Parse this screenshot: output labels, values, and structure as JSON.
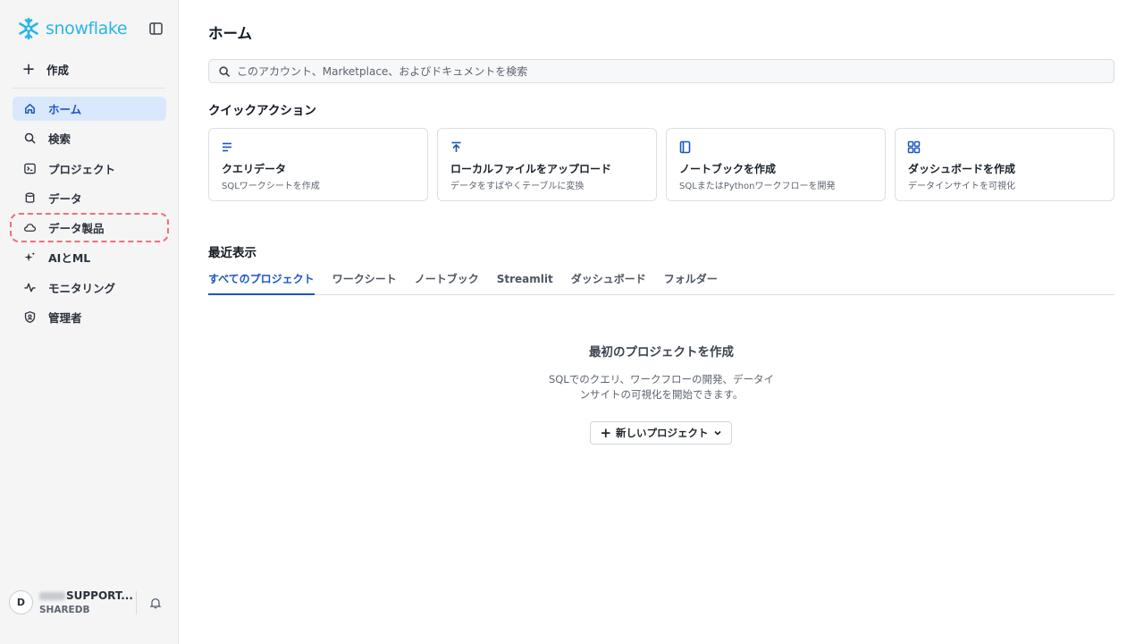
{
  "app": {
    "logo_text": "snowflake"
  },
  "sidebar": {
    "create_label": "作成",
    "items": [
      {
        "label": "ホーム",
        "icon": "home-icon",
        "active": true
      },
      {
        "label": "検索",
        "icon": "search-icon"
      },
      {
        "label": "プロジェクト",
        "icon": "terminal-icon"
      },
      {
        "label": "データ",
        "icon": "database-icon"
      },
      {
        "label": "データ製品",
        "icon": "cloud-icon",
        "highlighted": true
      },
      {
        "label": "AIとML",
        "icon": "sparkle-icon"
      },
      {
        "label": "モニタリング",
        "icon": "activity-icon"
      },
      {
        "label": "管理者",
        "icon": "shield-icon"
      }
    ],
    "account": {
      "initial": "D",
      "name": "SUPPORT...",
      "role": "SHAREDB"
    }
  },
  "main": {
    "title": "ホーム",
    "search_placeholder": "このアカウント、Marketplace、およびドキュメントを検索",
    "quick_actions_title": "クイックアクション",
    "quick_actions": [
      {
        "title": "クエリデータ",
        "desc": "SQLワークシートを作成",
        "icon": "lines-icon"
      },
      {
        "title": "ローカルファイルをアップロード",
        "desc": "データをすばやくテーブルに変換",
        "icon": "upload-icon"
      },
      {
        "title": "ノートブックを作成",
        "desc": "SQLまたはPythonワークフローを開発",
        "icon": "notebook-icon"
      },
      {
        "title": "ダッシュボードを作成",
        "desc": "データインサイトを可視化",
        "icon": "grid-icon"
      }
    ],
    "recent_title": "最近表示",
    "tabs": [
      "すべてのプロジェクト",
      "ワークシート",
      "ノートブック",
      "Streamlit",
      "ダッシュボード",
      "フォルダー"
    ],
    "active_tab": 0,
    "empty_title": "最初のプロジェクトを作成",
    "empty_desc_line1": "SQLでのクエリ、ワークフローの開発、データイ",
    "empty_desc_line2": "ンサイトの可視化を開始できます。",
    "new_project_label": "新しいプロジェクト"
  },
  "colors": {
    "accent": "#1a56c4",
    "brand": "#29b5e8",
    "highlight": "#ee6f7b",
    "active_bg": "#d9e8fc"
  }
}
